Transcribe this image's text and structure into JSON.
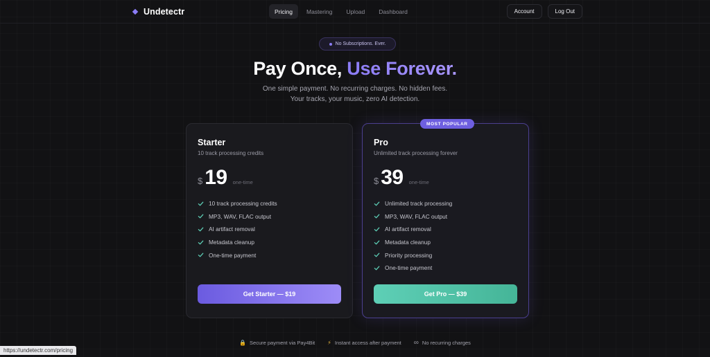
{
  "nav": {
    "logo": "Undetectr",
    "links": [
      "Pricing",
      "Mastering",
      "Upload",
      "Dashboard"
    ],
    "active_link": "Pricing",
    "account_label": "Account",
    "logout_label": "Log Out"
  },
  "hero": {
    "pill_text": "No Subscriptions. Ever.",
    "title_plain": "Pay Once, ",
    "title_accent": "Use Forever.",
    "subtitle_line1": "One simple payment. No recurring charges. No hidden fees.",
    "subtitle_line2": "Your tracks, your music, zero AI detection."
  },
  "plans": [
    {
      "name": "Starter",
      "description": "10 track processing credits",
      "currency": "$",
      "price": "19",
      "period": "one-time",
      "features": [
        "10 track processing credits",
        "MP3, WAV, FLAC output",
        "AI artifact removal",
        "Metadata cleanup",
        "One-time payment"
      ],
      "cta": "Get Starter — $19"
    },
    {
      "name": "Pro",
      "badge": "MOST POPULAR",
      "description": "Unlimited track processing forever",
      "currency": "$",
      "price": "39",
      "period": "one-time",
      "features": [
        "Unlimited track processing",
        "MP3, WAV, FLAC output",
        "AI artifact removal",
        "Metadata cleanup",
        "Priority processing",
        "One-time payment"
      ],
      "cta": "Get Pro — $39"
    }
  ],
  "footer": {
    "items": [
      {
        "icon": "lock-icon",
        "text": "Secure payment via Pay4Bit"
      },
      {
        "icon": "bolt-icon",
        "text": "Instant access after payment"
      },
      {
        "icon": "infinity-icon",
        "text": "No recurring charges"
      }
    ]
  },
  "status_url": "https://undetectr.com/pricing",
  "colors": {
    "accent": "#8b7cf6",
    "check": "#5ecfb6",
    "pro_button": "#4fc1a7",
    "starter_button": "#7d6cea"
  }
}
